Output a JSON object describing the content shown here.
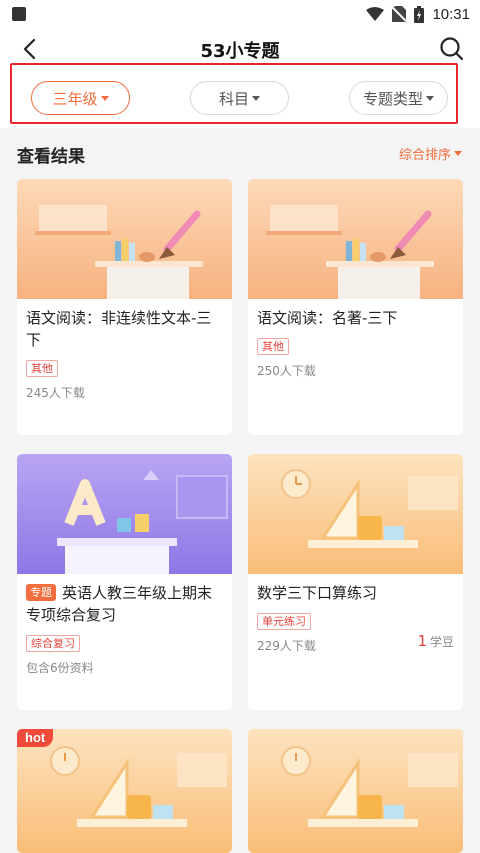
{
  "status_bar": {
    "time": "10:31"
  },
  "header": {
    "title": "53小专题"
  },
  "filters": [
    {
      "label": "三年级",
      "active": true
    },
    {
      "label": "科目",
      "active": false
    },
    {
      "label": "专题类型",
      "active": false
    }
  ],
  "results": {
    "title": "查看结果",
    "sort_label": "综合排序"
  },
  "cards": [
    {
      "title": "语文阅读：非连续性文本-三下",
      "tag": "其他",
      "meta": "245人下载"
    },
    {
      "title": "语文阅读：名著-三下",
      "tag": "其他",
      "meta": "250人下载"
    },
    {
      "special_badge": "专题",
      "title": "英语人教三年级上期末专项综合复习",
      "tag": "综合复习",
      "meta": "包含6份资料"
    },
    {
      "title": "数学三下口算练习",
      "tag": "单元练习",
      "meta": "229人下载",
      "price_value": "1",
      "price_unit": "学豆"
    },
    {
      "hot": "hot"
    },
    {}
  ],
  "colors": {
    "accent": "#f26d3d",
    "highlight_box": "#e8262d",
    "tag_red": "#e8403a"
  }
}
